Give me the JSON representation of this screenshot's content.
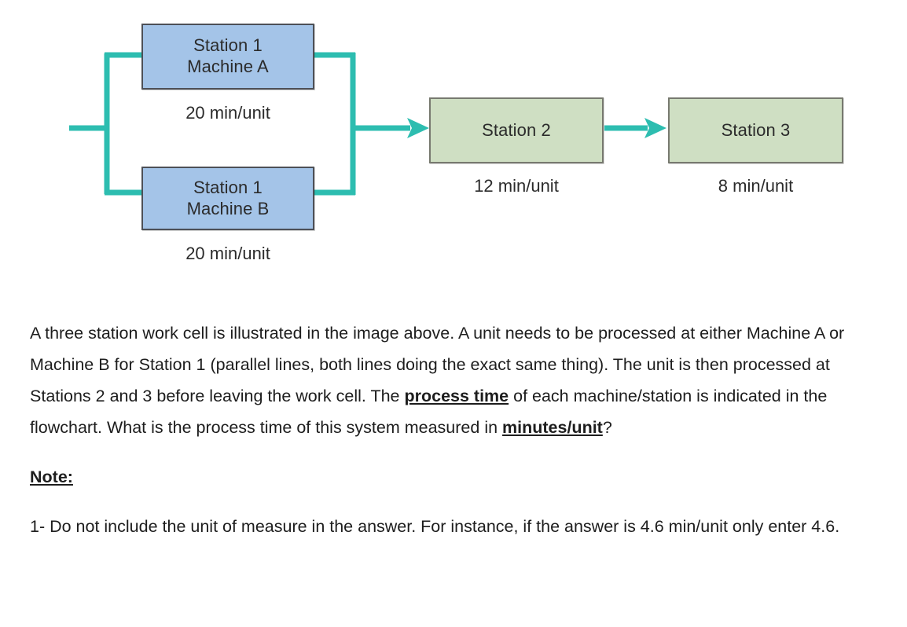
{
  "diagram": {
    "title": "three-station-work-cell-flowchart",
    "colors": {
      "connector": "#2dbdb0",
      "station1_fill": "#a4c4e8",
      "station1_border": "#4d5057",
      "station23_fill": "#cfdfc3",
      "station23_border": "#77796f"
    },
    "nodes": [
      {
        "id": "station1-machine-a",
        "line1": "Station 1",
        "line2": "Machine A",
        "caption": "20 min/unit",
        "process_time": 20,
        "unit": "min/unit",
        "style": "blue"
      },
      {
        "id": "station1-machine-b",
        "line1": "Station 1",
        "line2": "Machine B",
        "caption": "20 min/unit",
        "process_time": 20,
        "unit": "min/unit",
        "style": "blue"
      },
      {
        "id": "station2",
        "line1": "Station 2",
        "line2": "",
        "caption": "12 min/unit",
        "process_time": 12,
        "unit": "min/unit",
        "style": "green"
      },
      {
        "id": "station3",
        "line1": "Station 3",
        "line2": "",
        "caption": "8 min/unit",
        "process_time": 8,
        "unit": "min/unit",
        "style": "green"
      }
    ]
  },
  "prose": {
    "question_part1": "A three station work cell is illustrated in the image above. A unit needs to be processed at either Machine A or Machine B for Station 1 (parallel lines, both lines doing the exact same thing). The unit is then processed at Stations 2 and 3 before leaving the work cell. The ",
    "emphasis1": "process time",
    "question_part2": " of each machine/station is indicated in the flowchart. What is the process time of this system measured in ",
    "emphasis2": "minutes/unit",
    "question_part3": "?",
    "note_heading": "Note:",
    "note_item_1": "1- Do not include the unit of measure in the answer. For instance, if the answer is 4.6 min/unit only enter 4.6."
  }
}
